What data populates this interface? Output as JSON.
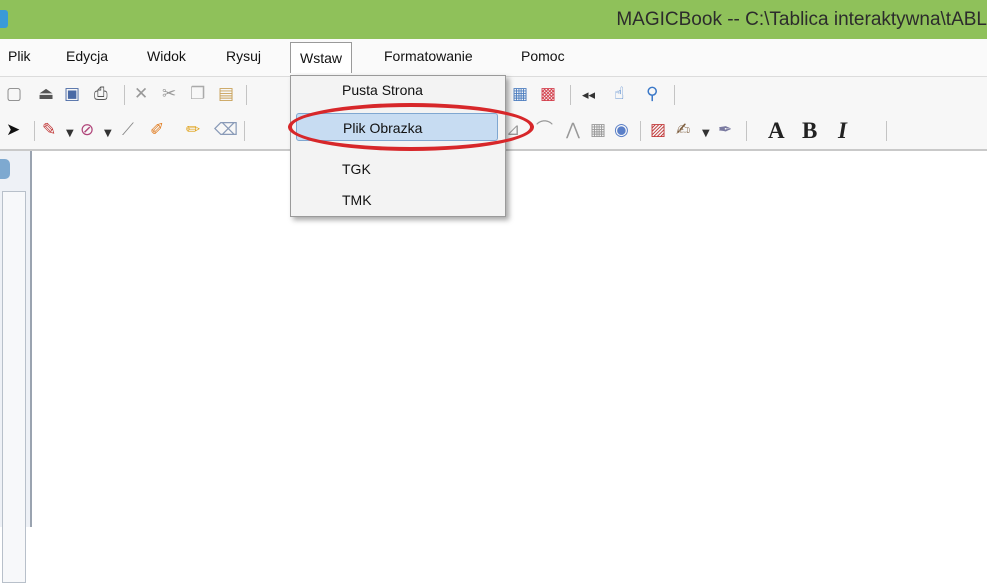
{
  "window": {
    "title": "MAGICBook -- C:\\Tablica interaktywna\\tABL",
    "titlebar_color": "#8fc15a"
  },
  "menubar": {
    "items": [
      "Plik",
      "Edycja",
      "Widok",
      "Rysuj",
      "Wstaw",
      "Formatowanie",
      "Pomoc"
    ],
    "active": "Wstaw"
  },
  "toolbar1": {
    "icons": [
      "new-page-icon",
      "open-icon",
      "save-icon",
      "print-icon",
      "delete-icon",
      "cut-icon",
      "copy-icon",
      "paste-icon",
      "grid-icon",
      "screen-capture-icon",
      "rewind-icon",
      "pointer-hand-icon",
      "magnifier-icon"
    ]
  },
  "toolbar2": {
    "icons": [
      "select-arrow-icon",
      "pen-icon",
      "shape-icon",
      "line-icon",
      "brush-icon",
      "highlighter-icon",
      "eraser-icon",
      "protractor-icon",
      "compass-icon",
      "calculator-icon",
      "clock-icon",
      "fill-icon",
      "text-color-icon",
      "pen-color-icon"
    ],
    "format_letters": [
      "A",
      "B",
      "I"
    ]
  },
  "dropdown": {
    "menu": "Wstaw",
    "items": [
      "Pusta Strona",
      "Plik  Obrazka",
      "TGK",
      "TMK"
    ],
    "highlighted": "Plik  Obrazka"
  },
  "annotation": {
    "type": "red-ellipse",
    "target": "Plik  Obrazka",
    "color": "#d7272a"
  }
}
